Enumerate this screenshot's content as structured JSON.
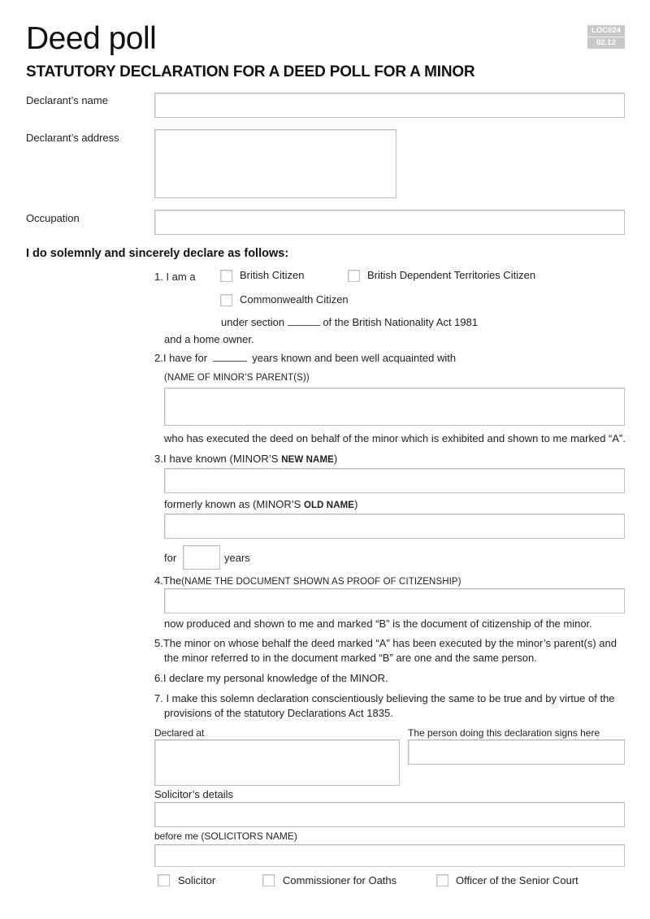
{
  "header": {
    "title": "Deed poll",
    "subtitle": "STATUTORY DECLARATION FOR A DEED POLL FOR A MINOR",
    "form_code": "LOC024",
    "form_version": "02.12"
  },
  "declarant": {
    "name_label": "Declarant’s name",
    "name_value": "",
    "address_label": "Declarant’s address",
    "address_value": "",
    "occupation_label": "Occupation",
    "occupation_value": ""
  },
  "declaration": {
    "heading": "I do solemnly and sincerely declare as follows:",
    "item1": {
      "prefix": "1. I am a",
      "options": [
        {
          "label": "British Citizen",
          "checked": false
        },
        {
          "label": "British Dependent Territories Citizen",
          "checked": false
        },
        {
          "label": "Commonwealth Citizen",
          "checked": false
        }
      ],
      "under_section_pre": "under section",
      "under_section_value": "",
      "under_section_post": "of the British Nationality Act 1981",
      "home_owner": "and a home owner."
    },
    "item2": {
      "pre": "2.I have for",
      "years_value": "",
      "post": "years known and been well acquainted with",
      "parent_label": "(NAME OF MINOR’S PARENT(S))",
      "parent_value": "",
      "executed_text": "who has executed the deed on behalf of the minor which is exhibited and shown to me marked “A”."
    },
    "item3": {
      "pre": "3.I have known (MINOR’S",
      "pre_bold": "NEW NAME",
      "pre_close": ")",
      "new_name_value": "",
      "formerly_pre": "formerly known as (MINOR’S",
      "formerly_bold": "OLD NAME",
      "formerly_close": ")",
      "old_name_value": "",
      "for_label": "for",
      "years_value": "",
      "years_label": "years"
    },
    "item4": {
      "pre": "4.The",
      "caps": "(NAME THE DOCUMENT SHOWN AS PROOF OF CITIZENSHIP)",
      "document_value": "",
      "post": "now produced and shown to me and marked “B” is the document of citizenship of the minor."
    },
    "item5": {
      "line1": "5.The minor on whose behalf the deed marked “A” has been executed by the minor’s parent(s) and",
      "line2": "the minor referred to in the document marked “B” are one and the same person."
    },
    "item6": "6.I declare my personal knowledge of the MINOR.",
    "item7": {
      "line1": "7. I make this solemn declaration conscientiously believing the same to be true and by virtue of the",
      "line2": "provisions of the statutory Declarations Act 1835."
    }
  },
  "signing": {
    "declared_at_label": "Declared at",
    "declared_at_value": "",
    "signature_label": "The person doing this declaration signs here",
    "signature_value": "",
    "solicitor_details_label": "Solicitor’s details",
    "solicitor_details_value": "",
    "before_me_label": "before me (SOLICITORS NAME)",
    "before_me_value": "",
    "roles": [
      {
        "label": "Solicitor",
        "checked": false
      },
      {
        "label": "Commissioner for Oaths",
        "checked": false
      },
      {
        "label": "Officer of the Senior Court",
        "checked": false
      }
    ]
  }
}
